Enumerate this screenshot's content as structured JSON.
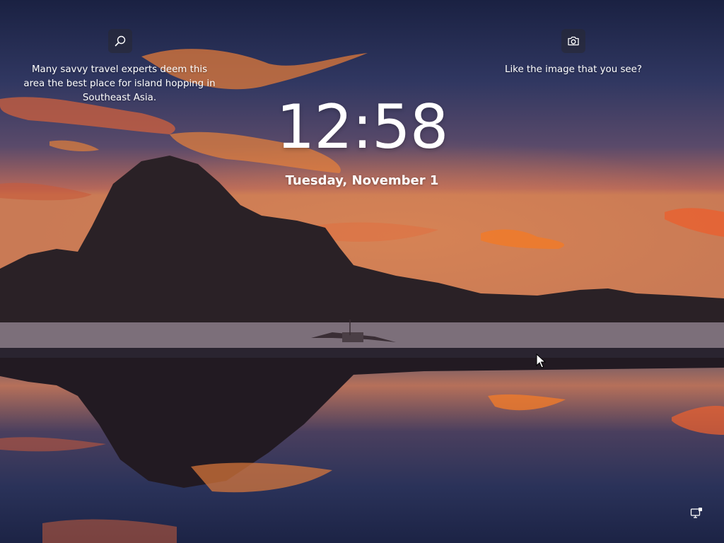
{
  "lockscreen": {
    "time": "12:58",
    "date": "Tuesday, November 1",
    "spotlight": {
      "fact": "Many savvy travel experts deem this area the best place for island hopping in Southeast Asia.",
      "like_prompt": "Like the image that you see?"
    },
    "icons": {
      "search": "search-icon",
      "camera": "camera-icon",
      "network": "network-icon",
      "cursor": "mouse-pointer"
    }
  }
}
